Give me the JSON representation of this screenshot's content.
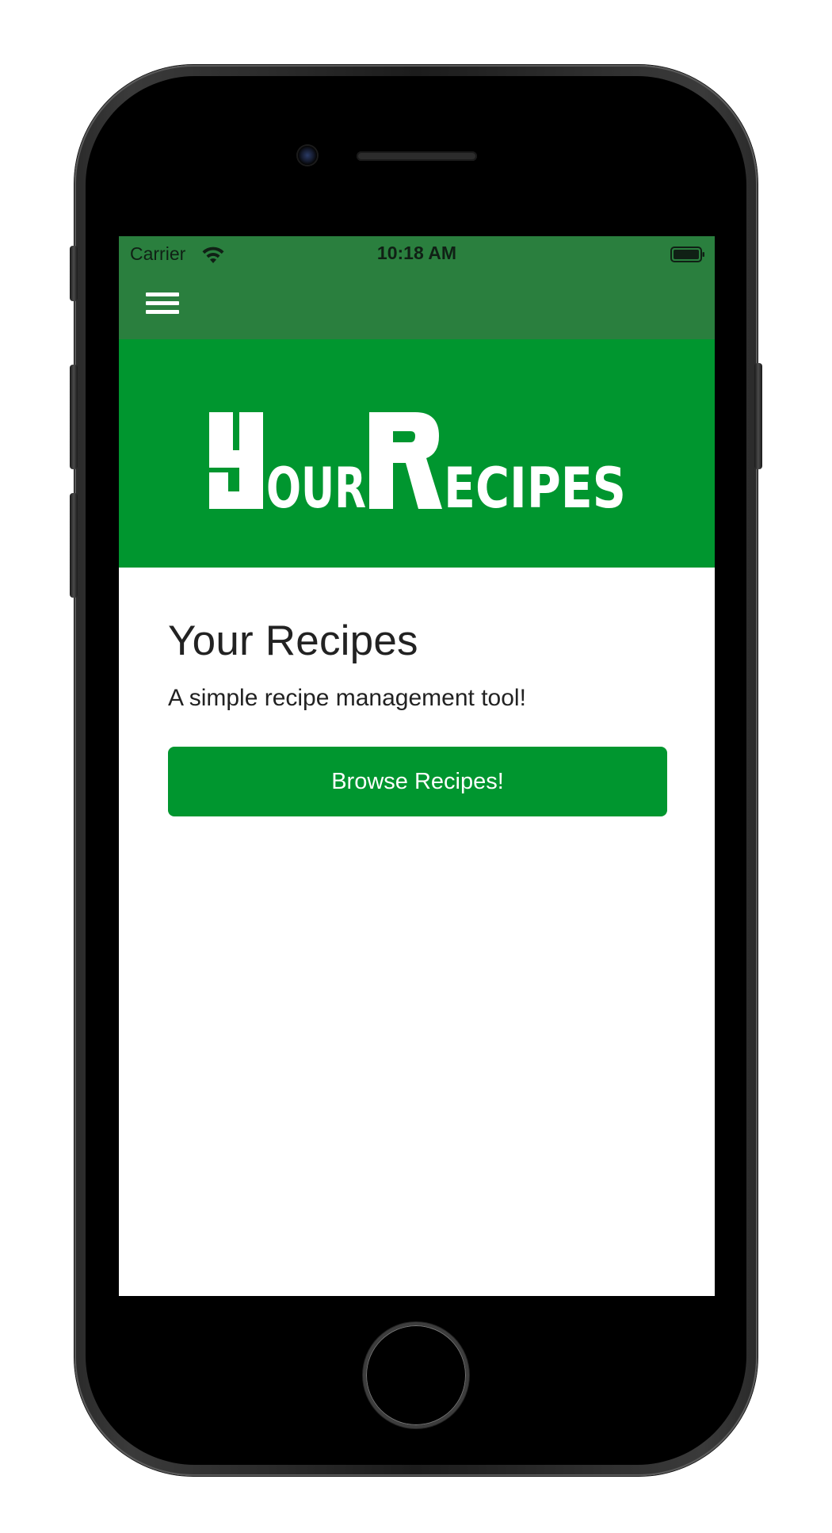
{
  "status_bar": {
    "carrier": "Carrier",
    "time": "10:18 AM",
    "wifi_icon": "wifi-icon",
    "battery_icon": "battery-full-icon"
  },
  "nav": {
    "menu_icon": "hamburger-menu-icon"
  },
  "banner": {
    "logo_text": "YourRecipes",
    "background_color": "#00962f"
  },
  "main": {
    "title": "Your Recipes",
    "subtitle": "A simple recipe management tool!",
    "browse_button_label": "Browse Recipes!"
  },
  "colors": {
    "header": "#2a7f3e",
    "accent": "#00962f",
    "text": "#222222"
  }
}
